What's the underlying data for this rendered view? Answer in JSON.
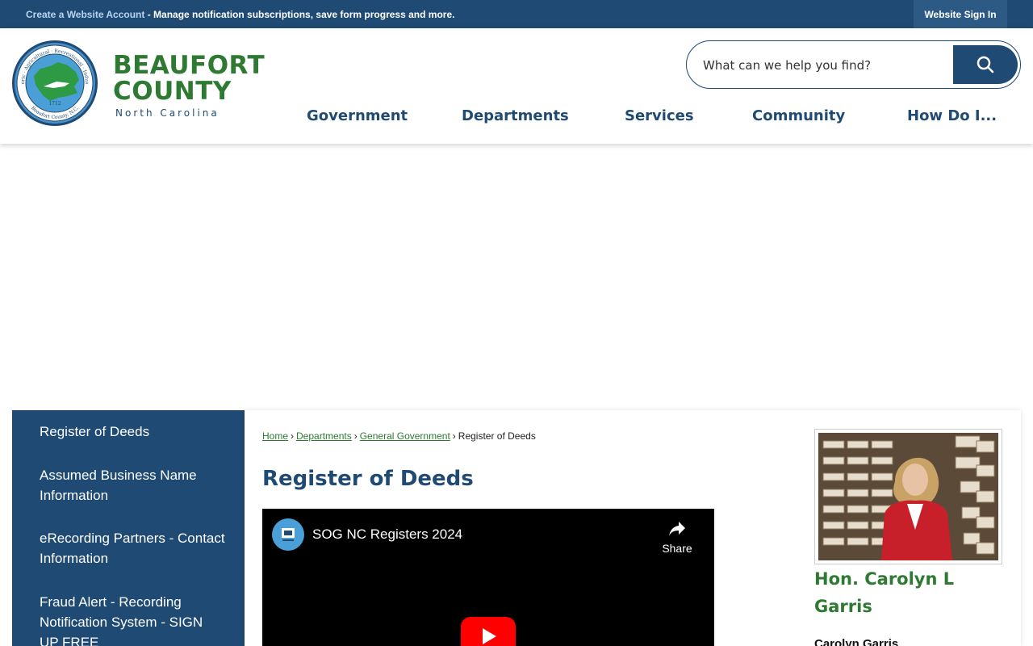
{
  "topbar": {
    "create_account_link": "Create a Website Account",
    "message": " - Manage notification subscriptions, save form progress and more.",
    "sign_in": "Website Sign In"
  },
  "header": {
    "brand_line1": "BEAUFORT",
    "brand_line2": "COUNTY",
    "brand_line3": "North Carolina",
    "seal": {
      "ring_top": "Historic · Agricultural · Recreational · Industrial",
      "ring_bottom": "Beaufort County, N.C.",
      "year": "1712"
    },
    "search_placeholder": "What can we help you find?",
    "nav": [
      {
        "label": "Government"
      },
      {
        "label": "Departments"
      },
      {
        "label": "Services"
      },
      {
        "label": "Community"
      },
      {
        "label": "How Do I..."
      }
    ]
  },
  "sidebar": {
    "items": [
      {
        "label": "Register of Deeds"
      },
      {
        "label": "Assumed Business Name Information"
      },
      {
        "label": "eRecording Partners - Contact Information"
      },
      {
        "label": "Fraud Alert - Recording Notification System - SIGN UP FREE"
      }
    ]
  },
  "content": {
    "breadcrumb": [
      {
        "label": "Home"
      },
      {
        "label": "Departments"
      },
      {
        "label": "General Government"
      }
    ],
    "breadcrumb_current": "Register of Deeds",
    "page_title": "Register of Deeds",
    "video": {
      "title": "SOG NC Registers 2024",
      "share_label": "Share"
    },
    "person": {
      "name": "Hon. Carolyn L Garris",
      "subtitle": "Carolyn Garris"
    }
  },
  "colors": {
    "primary_blue": "#1f4a73",
    "brand_green": "#2f7a33",
    "youtube_red": "#ff0000"
  }
}
